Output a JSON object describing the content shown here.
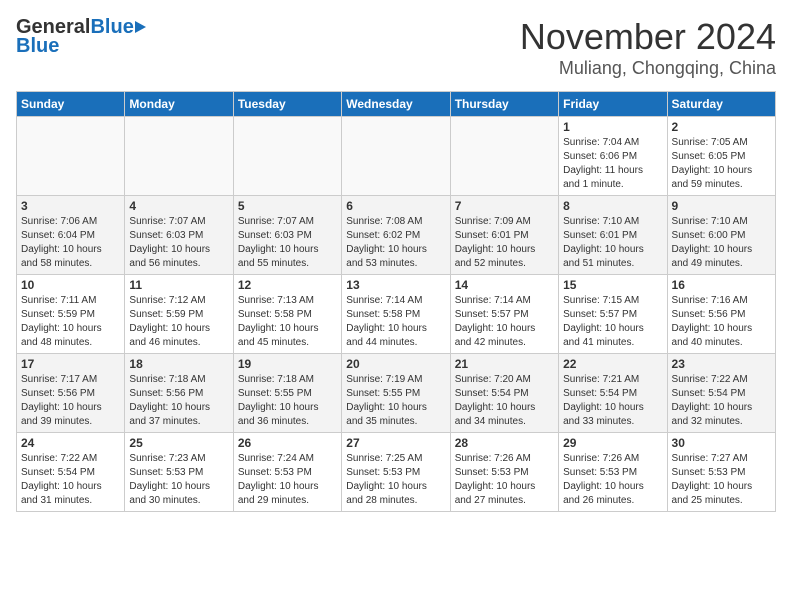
{
  "header": {
    "logo_general": "General",
    "logo_blue": "Blue",
    "title": "November 2024",
    "subtitle": "Muliang, Chongqing, China"
  },
  "calendar": {
    "headers": [
      "Sunday",
      "Monday",
      "Tuesday",
      "Wednesday",
      "Thursday",
      "Friday",
      "Saturday"
    ],
    "weeks": [
      [
        {
          "day": "",
          "info": ""
        },
        {
          "day": "",
          "info": ""
        },
        {
          "day": "",
          "info": ""
        },
        {
          "day": "",
          "info": ""
        },
        {
          "day": "",
          "info": ""
        },
        {
          "day": "1",
          "info": "Sunrise: 7:04 AM\nSunset: 6:06 PM\nDaylight: 11 hours\nand 1 minute."
        },
        {
          "day": "2",
          "info": "Sunrise: 7:05 AM\nSunset: 6:05 PM\nDaylight: 10 hours\nand 59 minutes."
        }
      ],
      [
        {
          "day": "3",
          "info": "Sunrise: 7:06 AM\nSunset: 6:04 PM\nDaylight: 10 hours\nand 58 minutes."
        },
        {
          "day": "4",
          "info": "Sunrise: 7:07 AM\nSunset: 6:03 PM\nDaylight: 10 hours\nand 56 minutes."
        },
        {
          "day": "5",
          "info": "Sunrise: 7:07 AM\nSunset: 6:03 PM\nDaylight: 10 hours\nand 55 minutes."
        },
        {
          "day": "6",
          "info": "Sunrise: 7:08 AM\nSunset: 6:02 PM\nDaylight: 10 hours\nand 53 minutes."
        },
        {
          "day": "7",
          "info": "Sunrise: 7:09 AM\nSunset: 6:01 PM\nDaylight: 10 hours\nand 52 minutes."
        },
        {
          "day": "8",
          "info": "Sunrise: 7:10 AM\nSunset: 6:01 PM\nDaylight: 10 hours\nand 51 minutes."
        },
        {
          "day": "9",
          "info": "Sunrise: 7:10 AM\nSunset: 6:00 PM\nDaylight: 10 hours\nand 49 minutes."
        }
      ],
      [
        {
          "day": "10",
          "info": "Sunrise: 7:11 AM\nSunset: 5:59 PM\nDaylight: 10 hours\nand 48 minutes."
        },
        {
          "day": "11",
          "info": "Sunrise: 7:12 AM\nSunset: 5:59 PM\nDaylight: 10 hours\nand 46 minutes."
        },
        {
          "day": "12",
          "info": "Sunrise: 7:13 AM\nSunset: 5:58 PM\nDaylight: 10 hours\nand 45 minutes."
        },
        {
          "day": "13",
          "info": "Sunrise: 7:14 AM\nSunset: 5:58 PM\nDaylight: 10 hours\nand 44 minutes."
        },
        {
          "day": "14",
          "info": "Sunrise: 7:14 AM\nSunset: 5:57 PM\nDaylight: 10 hours\nand 42 minutes."
        },
        {
          "day": "15",
          "info": "Sunrise: 7:15 AM\nSunset: 5:57 PM\nDaylight: 10 hours\nand 41 minutes."
        },
        {
          "day": "16",
          "info": "Sunrise: 7:16 AM\nSunset: 5:56 PM\nDaylight: 10 hours\nand 40 minutes."
        }
      ],
      [
        {
          "day": "17",
          "info": "Sunrise: 7:17 AM\nSunset: 5:56 PM\nDaylight: 10 hours\nand 39 minutes."
        },
        {
          "day": "18",
          "info": "Sunrise: 7:18 AM\nSunset: 5:56 PM\nDaylight: 10 hours\nand 37 minutes."
        },
        {
          "day": "19",
          "info": "Sunrise: 7:18 AM\nSunset: 5:55 PM\nDaylight: 10 hours\nand 36 minutes."
        },
        {
          "day": "20",
          "info": "Sunrise: 7:19 AM\nSunset: 5:55 PM\nDaylight: 10 hours\nand 35 minutes."
        },
        {
          "day": "21",
          "info": "Sunrise: 7:20 AM\nSunset: 5:54 PM\nDaylight: 10 hours\nand 34 minutes."
        },
        {
          "day": "22",
          "info": "Sunrise: 7:21 AM\nSunset: 5:54 PM\nDaylight: 10 hours\nand 33 minutes."
        },
        {
          "day": "23",
          "info": "Sunrise: 7:22 AM\nSunset: 5:54 PM\nDaylight: 10 hours\nand 32 minutes."
        }
      ],
      [
        {
          "day": "24",
          "info": "Sunrise: 7:22 AM\nSunset: 5:54 PM\nDaylight: 10 hours\nand 31 minutes."
        },
        {
          "day": "25",
          "info": "Sunrise: 7:23 AM\nSunset: 5:53 PM\nDaylight: 10 hours\nand 30 minutes."
        },
        {
          "day": "26",
          "info": "Sunrise: 7:24 AM\nSunset: 5:53 PM\nDaylight: 10 hours\nand 29 minutes."
        },
        {
          "day": "27",
          "info": "Sunrise: 7:25 AM\nSunset: 5:53 PM\nDaylight: 10 hours\nand 28 minutes."
        },
        {
          "day": "28",
          "info": "Sunrise: 7:26 AM\nSunset: 5:53 PM\nDaylight: 10 hours\nand 27 minutes."
        },
        {
          "day": "29",
          "info": "Sunrise: 7:26 AM\nSunset: 5:53 PM\nDaylight: 10 hours\nand 26 minutes."
        },
        {
          "day": "30",
          "info": "Sunrise: 7:27 AM\nSunset: 5:53 PM\nDaylight: 10 hours\nand 25 minutes."
        }
      ]
    ]
  }
}
